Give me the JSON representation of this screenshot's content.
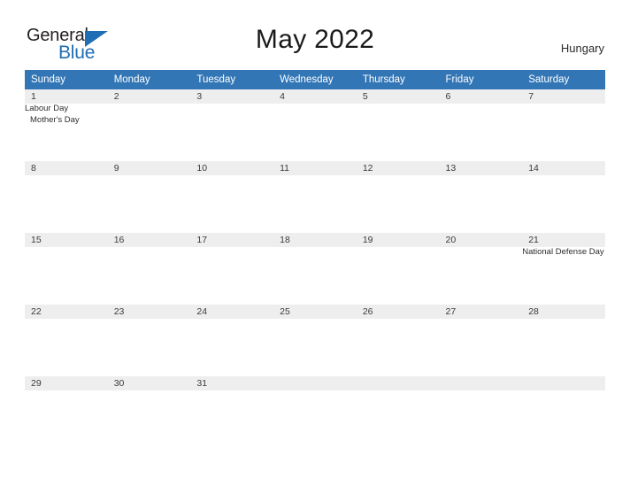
{
  "brand": {
    "name_part1": "General",
    "name_part2": "Blue",
    "triangle_icon": "triangle-icon",
    "accent_color": "#1f6db5"
  },
  "header": {
    "title": "May 2022",
    "country": "Hungary"
  },
  "colors": {
    "header_blue": "#3276b6",
    "date_band_gray": "#eeeeee",
    "text_dark": "#2d2d2d"
  },
  "calendar": {
    "weekday_headers": [
      "Sunday",
      "Monday",
      "Tuesday",
      "Wednesday",
      "Thursday",
      "Friday",
      "Saturday"
    ],
    "weeks": [
      {
        "dates": [
          "1",
          "2",
          "3",
          "4",
          "5",
          "6",
          "7"
        ],
        "events": [
          [
            "Labour Day",
            "Mother's Day"
          ],
          [],
          [],
          [],
          [],
          [],
          []
        ]
      },
      {
        "dates": [
          "8",
          "9",
          "10",
          "11",
          "12",
          "13",
          "14"
        ],
        "events": [
          [],
          [],
          [],
          [],
          [],
          [],
          []
        ]
      },
      {
        "dates": [
          "15",
          "16",
          "17",
          "18",
          "19",
          "20",
          "21"
        ],
        "events": [
          [],
          [],
          [],
          [],
          [],
          [],
          [
            "National Defense Day"
          ]
        ]
      },
      {
        "dates": [
          "22",
          "23",
          "24",
          "25",
          "26",
          "27",
          "28"
        ],
        "events": [
          [],
          [],
          [],
          [],
          [],
          [],
          []
        ]
      },
      {
        "dates": [
          "29",
          "30",
          "31",
          "",
          "",
          "",
          ""
        ],
        "events": [
          [],
          [],
          [],
          [],
          [],
          [],
          []
        ]
      }
    ]
  }
}
